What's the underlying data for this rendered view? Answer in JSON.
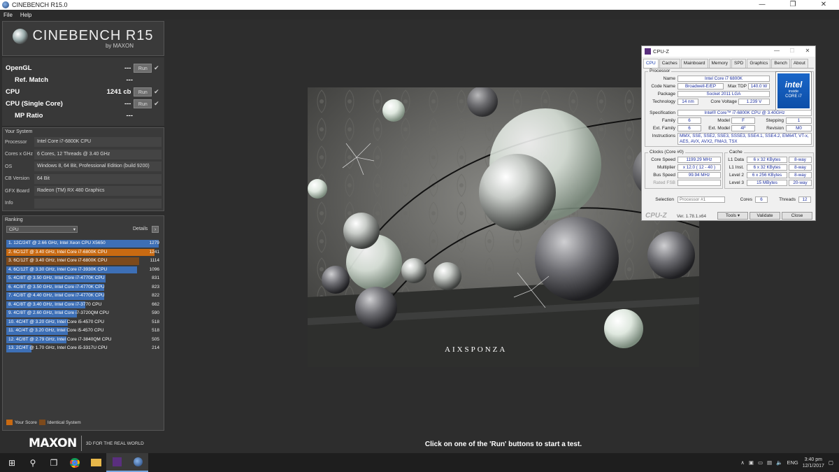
{
  "window": {
    "title": "CINEBENCH R15.0",
    "controls": [
      "—",
      "❐",
      "✕"
    ]
  },
  "menu": [
    "File",
    "Help"
  ],
  "logo": {
    "name": "CINEBENCH R15",
    "by": "by MAXON"
  },
  "tests": [
    {
      "label": "OpenGL",
      "value": "---",
      "has_run": true,
      "checked": true,
      "indent": false
    },
    {
      "label": "Ref. Match",
      "value": "---",
      "has_run": false,
      "checked": false,
      "indent": true
    },
    {
      "label": "CPU",
      "value": "1241 cb",
      "has_run": true,
      "checked": true,
      "indent": false
    },
    {
      "label": "CPU (Single Core)",
      "value": "---",
      "has_run": true,
      "checked": true,
      "indent": false
    },
    {
      "label": "MP Ratio",
      "value": "---",
      "has_run": false,
      "checked": false,
      "indent": true
    }
  ],
  "run_label": "Run",
  "system": {
    "title": "Your System",
    "rows": [
      {
        "key": "Processor",
        "value": "Intel Core i7-6800K CPU"
      },
      {
        "key": "Cores x GHz",
        "value": "6 Cores, 12 Threads @ 3.40 GHz"
      },
      {
        "key": "OS",
        "value": "Windows 8, 64 Bit, Professional Edition (build 9200)"
      },
      {
        "key": "CB Version",
        "value": "64 Bit"
      },
      {
        "key": "GFX Board",
        "value": "Radeon (TM) RX 480 Graphics"
      },
      {
        "key": "Info",
        "value": ""
      }
    ]
  },
  "ranking": {
    "title": "Ranking",
    "dropdown": "CPU",
    "details": "Details",
    "max_score": 1279,
    "items": [
      {
        "text": "1. 12C/24T @ 2.66 GHz, Intel Xeon CPU X5650",
        "score": 1279,
        "kind": "other"
      },
      {
        "text": "2. 6C/12T @ 3.40 GHz, Intel Core i7-6800K CPU",
        "score": 1241,
        "kind": "yours"
      },
      {
        "text": "3. 6C/12T @ 3.40 GHz, Intel Core i7-6800K CPU",
        "score": 1114,
        "kind": "identical"
      },
      {
        "text": "4. 6C/12T @ 3.30 GHz,  Intel Core i7-3930K CPU",
        "score": 1096,
        "kind": "other"
      },
      {
        "text": "5. 4C/8T @ 3.50 GHz, Intel Core i7-4770K CPU",
        "score": 831,
        "kind": "other"
      },
      {
        "text": "6. 4C/8T @ 3.50 GHz, Intel Core i7-4770K CPU",
        "score": 823,
        "kind": "other"
      },
      {
        "text": "7. 4C/8T @ 4.40 GHz, Intel Core i7-4770K CPU",
        "score": 822,
        "kind": "other"
      },
      {
        "text": "8. 4C/8T @ 3.40 GHz,  Intel Core i7-3770 CPU",
        "score": 662,
        "kind": "other"
      },
      {
        "text": "9. 4C/8T @ 2.60 GHz, Intel Core i7-3720QM CPU",
        "score": 590,
        "kind": "other"
      },
      {
        "text": "10. 4C/4T @ 3.20 GHz, Intel Core i5-4570 CPU",
        "score": 518,
        "kind": "other"
      },
      {
        "text": "11. 4C/4T @ 3.20 GHz, Intel Core i5-4570 CPU",
        "score": 518,
        "kind": "other"
      },
      {
        "text": "12. 4C/8T @ 2.79 GHz,  Intel Core i7-3840QM CPU",
        "score": 505,
        "kind": "other"
      },
      {
        "text": "13. 2C/4T @ 1.70 GHz,  Intel Core i5-3317U CPU",
        "score": 214,
        "kind": "other"
      }
    ],
    "legend_yours": "Your Score",
    "legend_identical": "Identical System"
  },
  "colors": {
    "yours": "#c96a12",
    "identical": "#7d4a1c",
    "other": "#3d6fb6"
  },
  "footer": {
    "brand": "MAXON",
    "tagline": "3D FOR THE REAL WORLD"
  },
  "render": {
    "watermark": "AIXSPONZA"
  },
  "hint": "Click on one of the 'Run' buttons to start a test.",
  "cpuz": {
    "title": "CPU-Z",
    "tabs": [
      "CPU",
      "Caches",
      "Mainboard",
      "Memory",
      "SPD",
      "Graphics",
      "Bench",
      "About"
    ],
    "processor_title": "Processor",
    "name_label": "Name",
    "name": "Intel Core i7 6800K",
    "codename_label": "Code Name",
    "codename": "Broadwell-E/EP",
    "tdp_label": "Max TDP",
    "tdp": "140.0 W",
    "package_label": "Package",
    "package": "Socket 2011 LGA",
    "tech_label": "Technology",
    "tech": "14 nm",
    "voltage_label": "Core Voltage",
    "voltage": "1.239 V",
    "spec_label": "Specification",
    "spec": "Intel® Core™ i7-6800K CPU @ 3.40GHz",
    "family_label": "Family",
    "family": "6",
    "model_label": "Model",
    "model": "F",
    "stepping_label": "Stepping",
    "stepping": "1",
    "extfamily_label": "Ext. Family",
    "extfamily": "6",
    "extmodel_label": "Ext. Model",
    "extmodel": "4F",
    "revision_label": "Revision",
    "revision": "M0",
    "instr_label": "Instructions",
    "instr": "MMX, SSE, SSE2, SSE3, SSSE3, SSE4.1, SSE4.2, EM64T, VT-x, AES, AVX, AVX2, FMA3, TSX",
    "clocks_title": "Clocks (Core #0)",
    "corespeed_label": "Core Speed",
    "corespeed": "1199.29 MHz",
    "multiplier_label": "Multiplier",
    "multiplier": "x 12.0 ( 12 - 40 )",
    "busspeed_label": "Bus Speed",
    "busspeed": "99.94 MHz",
    "ratedfsb_label": "Rated FSB",
    "ratedfsb": "",
    "cache_title": "Cache",
    "l1d_label": "L1 Data",
    "l1d": "6 x 32 KBytes",
    "l1d_way": "8-way",
    "l1i_label": "L1 Inst.",
    "l1i": "6 x 32 KBytes",
    "l1i_way": "8-way",
    "l2_label": "Level 2",
    "l2": "6 x 256 KBytes",
    "l2_way": "8-way",
    "l3_label": "Level 3",
    "l3": "15 MBytes",
    "l3_way": "20-way",
    "selection_label": "Selection",
    "selection": "Processor #1",
    "cores_label": "Cores",
    "cores": "6",
    "threads_label": "Threads",
    "threads": "12",
    "brand": "CPU-Z",
    "version": "Ver. 1.78.1.x64",
    "tools": "Tools",
    "validate": "Validate",
    "close": "Close",
    "intel_logo": "intel",
    "intel_inside": "inside",
    "intel_core": "CORE i7"
  },
  "taskbar": {
    "lang": "ENG",
    "time": "3:40 pm",
    "date": "12/1/2017"
  }
}
